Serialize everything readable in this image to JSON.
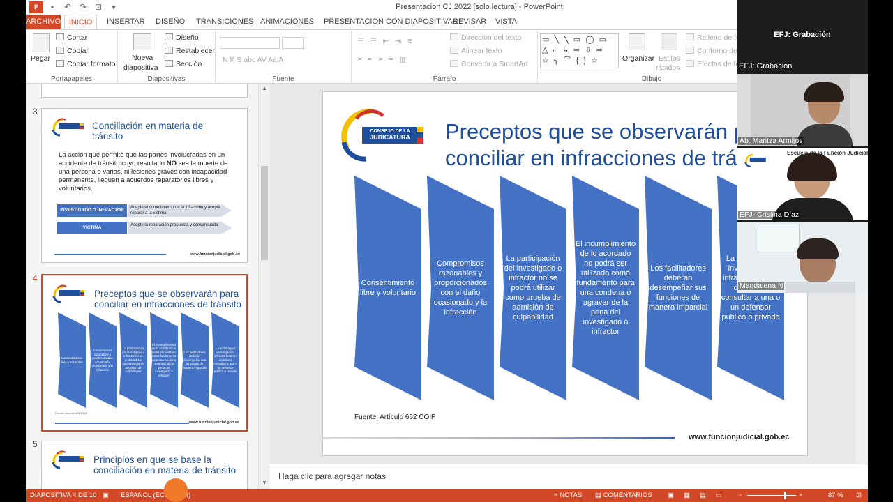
{
  "app": {
    "window_title": "Presentacion CJ 2022 [solo lectura] - PowerPoint",
    "logo_text": "P"
  },
  "tabs": [
    "ARCHIVO",
    "INICIO",
    "INSERTAR",
    "DISEÑO",
    "TRANSICIONES",
    "ANIMACIONES",
    "PRESENTACIÓN CON DIAPOSITIVAS",
    "REVISAR",
    "VISTA"
  ],
  "ribbon": {
    "portapapeles": {
      "label": "Portapapeles",
      "pegar": "Pegar",
      "cortar": "Cortar",
      "copiar": "Copiar",
      "copiar_formato": "Copiar formato"
    },
    "diapositivas": {
      "label": "Diapositivas",
      "nueva_1": "Nueva",
      "nueva_2": "diapositiva",
      "diseno": "Diseño",
      "restablecer": "Restablecer",
      "seccion": "Sección"
    },
    "fuente": {
      "label": "Fuente",
      "format_buttons": "N  K  S  abc  AV  Aa  A"
    },
    "parrafo": {
      "label": "Párrafo",
      "direccion": "Dirección del texto",
      "alinear": "Alinear texto",
      "convertir": "Convertir a SmartArt"
    },
    "dibujo": {
      "label": "Dibujo",
      "shapes_row1": "▭ ╲ ╲ ▭ ◯ ▭",
      "shapes_row2": "△ ⌐ ↳ ⇨ ⇩ ⇨",
      "shapes_row3": "☆ ╮ ⌒ { } ☆",
      "organizar": "Organizar",
      "estilos_1": "Estilos",
      "estilos_2": "rápidos",
      "relleno": "Relleno de fo",
      "contorno": "Contorno de",
      "efectos": "Efectos de fo"
    }
  },
  "thumbnails": [
    {
      "number": "3",
      "title": "Conciliación en materia de tránsito",
      "body_before": "La acción que permite que las partes involucradas en un accidente de tránsito cuyo resultado ",
      "body_bold": "NO",
      "body_after": " sea la muerte de una persona o varias, ni lesiones graves con incapacidad permanente, lleguen a acuerdos reparatorios libres y voluntarios.",
      "rows": [
        {
          "label": "INVESTIGADO O INFRACTOR",
          "text": "Acepte el cometimiento de la infracción y acepte reparar a la víctima"
        },
        {
          "label": "VÍCTIMA",
          "text": "Acepte la reparación propuesta y consensuada"
        }
      ],
      "footer": "www.funcionjudicial.gob.ec"
    },
    {
      "number": "4",
      "title": "Preceptos que se observarán para conciliar en infracciones de tránsito",
      "chevrons": [
        "Consentimiento libre y voluntario",
        "Compromisos razonables y proporcionados con el daño ocasionado y la infracción",
        "La participación del investigado o infractor no se podrá utilizar como prueba de admisión de culpabilidad",
        "El incumplimiento de lo acordado no podrá ser utilizado como fundamento para una condena o agravar de la pena del investigado o infractor",
        "Los facilitadores deberán desempeñar sus funciones de manera imparcial",
        "La víctima y el investigado o infractor tendrán derecho a consultar a una o un defensor público o privado"
      ],
      "source": "Fuente: Artículo 662 COIP",
      "footer": "www.funcionjudicial.gob.ec"
    },
    {
      "number": "5",
      "title": "Principios en que se base la conciliación en materia de tránsito"
    }
  ],
  "slide": {
    "title_line1": "Preceptos que se observarán para",
    "title_line2": "conciliar en infracciones de tránsito",
    "logo_line1": "CONSEJO DE LA",
    "logo_line2": "JUDICATURA",
    "chevrons": [
      "Consentimiento libre y voluntario",
      "Compromisos razonables y proporcionados con el daño ocasionado y la infracción",
      "La participación del investigado o infractor no se podrá utilizar como prueba de admisión de culpabilidad",
      "El incumplimiento de lo acordado no podrá ser utilizado como fundamento para una condena o agravar de la pena del investigado o infractor",
      "Los facilitadores deberán desempeñar sus funciones de manera imparcial",
      "La víctima y el investigado o infractor tendrán derecho a consultar a una o un defensor público o privado"
    ],
    "source": "Fuente: Artículo 662 COIP",
    "url": "www.funcionjudicial.gob.ec",
    "chevron_color": "#4472c4"
  },
  "notes_placeholder": "Haga clic para agregar notas",
  "status": {
    "slide_of": "DIAPOSITIVA 4 DE 10",
    "language": "ESPAÑOL (ECUADOR)",
    "notes": "NOTAS",
    "comments": "COMENTARIOS",
    "zoom": "87 %"
  },
  "video_call": {
    "recording_title": "EFJ: Grabación",
    "recording_subtitle": "EFJ: Grabación",
    "participants": [
      {
        "name": "Ab. Maritza Armijos"
      },
      {
        "name": "EFJ- Cristina Díaz",
        "backdrop_text": "Escuela de la Función Judicial"
      },
      {
        "name": "Magdalena N"
      }
    ]
  },
  "colors": {
    "accent": "#d24726",
    "title_blue": "#1f4e9d",
    "chevron_blue": "#4472c4"
  }
}
